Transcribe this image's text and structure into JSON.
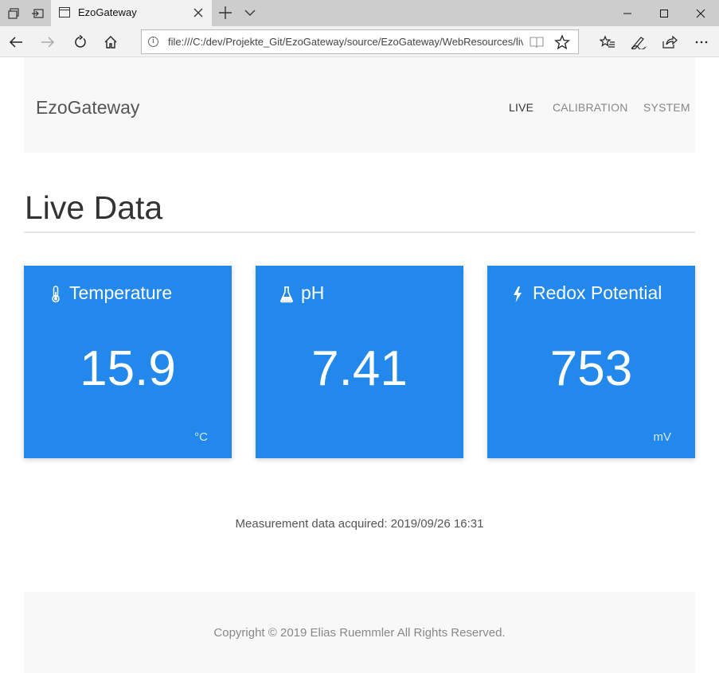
{
  "browser": {
    "tab_title": "EzoGateway",
    "url": "file:///C:/dev/Projekte_Git/EzoGateway/source/EzoGateway/WebResources/live.html"
  },
  "navbar": {
    "brand": "EzoGateway",
    "links": [
      {
        "label": "LIVE",
        "active": true
      },
      {
        "label": "CALIBRATION",
        "active": false
      },
      {
        "label": "SYSTEM",
        "active": false
      }
    ]
  },
  "page_title": "Live Data",
  "cards": [
    {
      "icon": "thermometer-icon",
      "title": "Temperature",
      "value": "15.9",
      "unit": "°C"
    },
    {
      "icon": "flask-icon",
      "title": "pH",
      "value": "7.41",
      "unit": ""
    },
    {
      "icon": "lightning-icon",
      "title": "Redox Potential",
      "value": "753",
      "unit": "mV"
    }
  ],
  "acquired": {
    "label": "Measurement data acquired:",
    "timestamp": "2019/09/26 16:31"
  },
  "footer": {
    "copyright": "Copyright © 2019 Elias Ruemmler All Rights Reserved."
  },
  "colors": {
    "card_bg": "#2288ec",
    "navbar_bg": "#f8f8f8",
    "footer_bg": "#f8f8f8"
  }
}
